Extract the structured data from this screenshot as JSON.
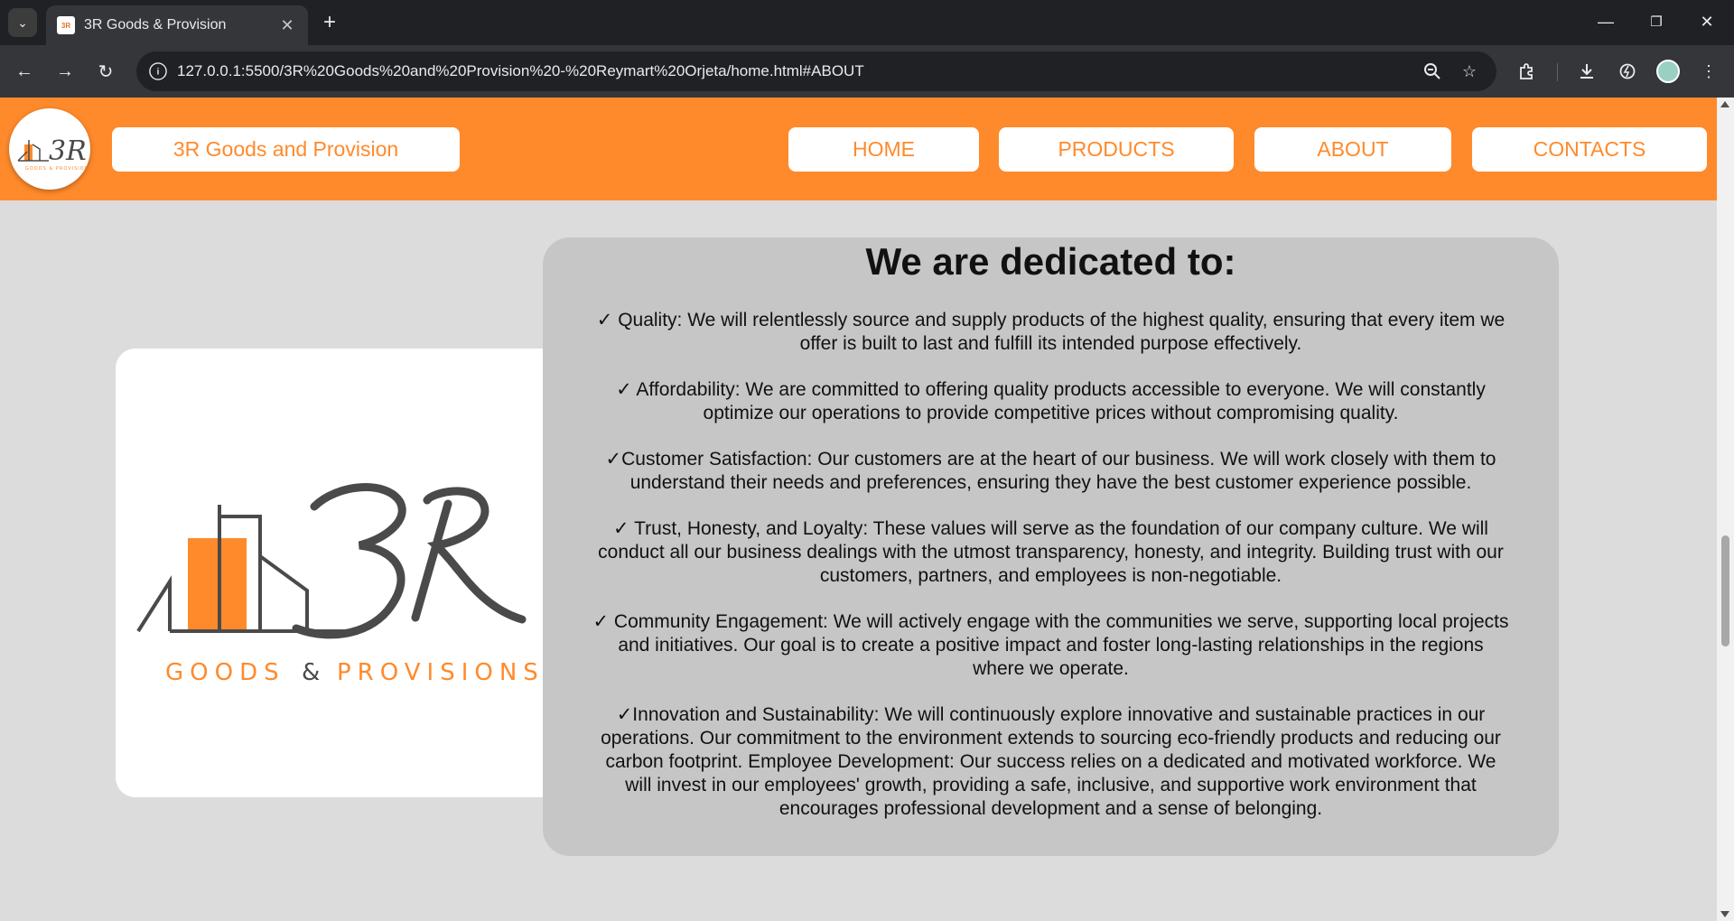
{
  "browser": {
    "tab_title": "3R Goods & Provision",
    "url": "127.0.0.1:5500/3R%20Goods%20and%20Provision%20-%20Reymart%20Orjeta/home.html#ABOUT"
  },
  "header": {
    "brand": "3R Goods and Provision",
    "nav": [
      "HOME",
      "PRODUCTS",
      "ABOUT",
      "CONTACTS"
    ]
  },
  "logo": {
    "mark": "3R",
    "tagline_left": "GOODS",
    "tagline_amp": "&",
    "tagline_right": "PROVISIONS"
  },
  "about": {
    "title": "We are dedicated to:",
    "items": [
      "✓ Quality: We will relentlessly source and supply products of the highest quality, ensuring that every item we offer is built to last and fulfill its intended purpose effectively.",
      "✓ Affordability: We are committed to offering quality products accessible to everyone. We will constantly optimize our operations to provide competitive prices without compromising quality.",
      "✓Customer Satisfaction: Our customers are at the heart of our business. We will work closely with them to understand their needs and preferences, ensuring they have the best customer experience possible.",
      "✓ Trust, Honesty, and Loyalty: These values will serve as the foundation of our company culture. We will conduct all our business dealings with the utmost transparency, honesty, and integrity. Building trust with our customers, partners, and employees is non-negotiable.",
      "✓ Community Engagement: We will actively engage with the communities we serve, supporting local projects and initiatives. Our goal is to create a positive impact and foster long-lasting relationships in the regions where we operate.",
      "✓Innovation and Sustainability: We will continuously explore innovative and sustainable practices in our operations. Our commitment to the environment extends to sourcing eco-friendly products and reducing our carbon footprint. Employee Development: Our success relies on a dedicated and motivated workforce. We will invest in our employees' growth, providing a safe, inclusive, and supportive work environment that encourages professional development and a sense of belonging."
    ]
  },
  "colors": {
    "accent": "#ff8a2b",
    "page_bg": "#dcdcdc",
    "card_bg": "#c6c6c6",
    "logo_dark": "#4a4a4a"
  },
  "icons": {
    "tab_list": "chevron-down-icon",
    "close": "close-icon",
    "new_tab": "plus-icon",
    "back": "arrow-left-icon",
    "forward": "arrow-right-icon",
    "reload": "reload-icon",
    "site_info": "info-icon",
    "zoom": "zoom-out-icon",
    "bookmark": "star-icon",
    "extensions": "puzzle-icon",
    "downloads": "download-icon",
    "performance": "gauge-icon",
    "menu": "kebab-menu-icon"
  },
  "scrollbar": {
    "position_fraction": 0.62,
    "visible_fraction": 0.14
  }
}
